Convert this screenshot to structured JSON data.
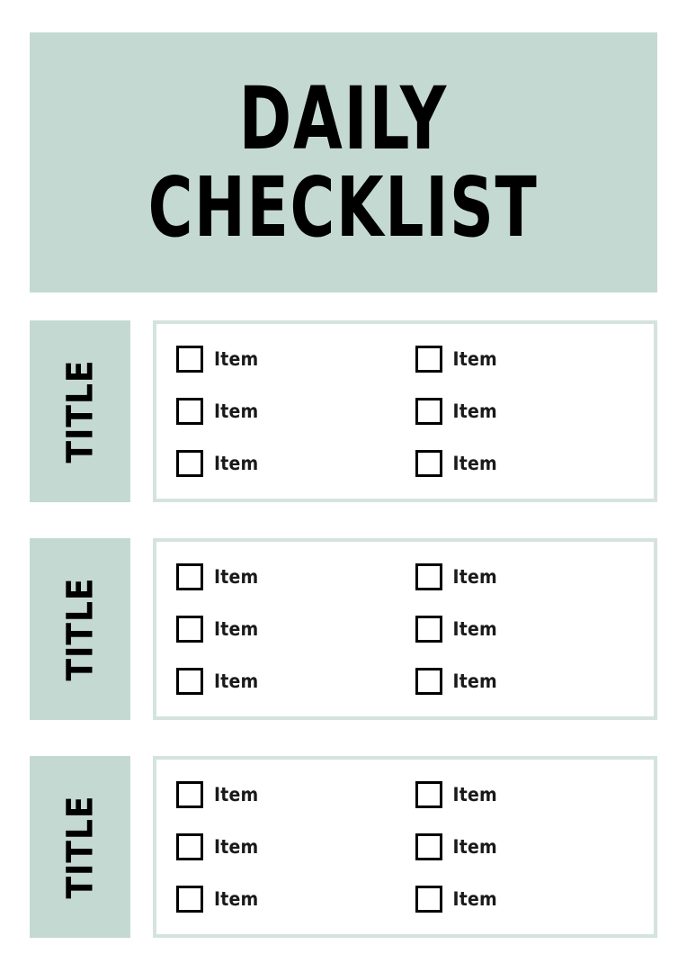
{
  "document": {
    "header": {
      "line_1": "DAILY",
      "line_2": "CHECKLIST"
    },
    "colors": {
      "accent_mint": "#c5d9d3",
      "panel_border": "#d4e3de",
      "text_black": "#000000",
      "page_background": "#ffffff"
    },
    "sections": [
      {
        "title": "TITLE",
        "columns": [
          {
            "items": [
              {
                "label": "Item",
                "checked": false
              },
              {
                "label": "Item",
                "checked": false
              },
              {
                "label": "Item",
                "checked": false
              }
            ]
          },
          {
            "items": [
              {
                "label": "Item",
                "checked": false
              },
              {
                "label": "Item",
                "checked": false
              },
              {
                "label": "Item",
                "checked": false
              }
            ]
          }
        ]
      },
      {
        "title": "TITLE",
        "columns": [
          {
            "items": [
              {
                "label": "Item",
                "checked": false
              },
              {
                "label": "Item",
                "checked": false
              },
              {
                "label": "Item",
                "checked": false
              }
            ]
          },
          {
            "items": [
              {
                "label": "Item",
                "checked": false
              },
              {
                "label": "Item",
                "checked": false
              },
              {
                "label": "Item",
                "checked": false
              }
            ]
          }
        ]
      },
      {
        "title": "TITLE",
        "columns": [
          {
            "items": [
              {
                "label": "Item",
                "checked": false
              },
              {
                "label": "Item",
                "checked": false
              },
              {
                "label": "Item",
                "checked": false
              }
            ]
          },
          {
            "items": [
              {
                "label": "Item",
                "checked": false
              },
              {
                "label": "Item",
                "checked": false
              },
              {
                "label": "Item",
                "checked": false
              }
            ]
          }
        ]
      }
    ]
  }
}
